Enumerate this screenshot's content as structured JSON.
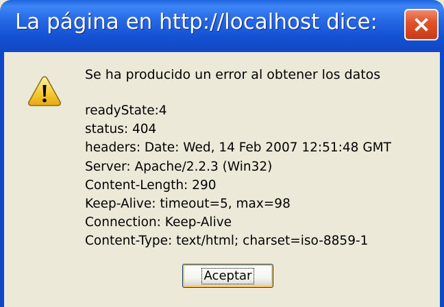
{
  "dialog": {
    "title": "La página en http://localhost dice:",
    "close_icon": "close-icon",
    "warning_icon": "warning-icon",
    "message": "Se ha producido un error al obtener los datos",
    "details": [
      "readyState:4",
      "status: 404",
      "headers: Date: Wed, 14 Feb 2007 12:51:48 GMT",
      "Server: Apache/2.2.3 (Win32)",
      "Content-Length: 290",
      "Keep-Alive: timeout=5, max=98",
      "Connection: Keep-Alive",
      "Content-Type: text/html; charset=iso-8859-1"
    ],
    "ok_label": "Aceptar"
  },
  "colors": {
    "titlebar": "#2a6be8",
    "background": "#ece9d8",
    "close_button": "#e2542c",
    "warning": "#f5c842"
  }
}
